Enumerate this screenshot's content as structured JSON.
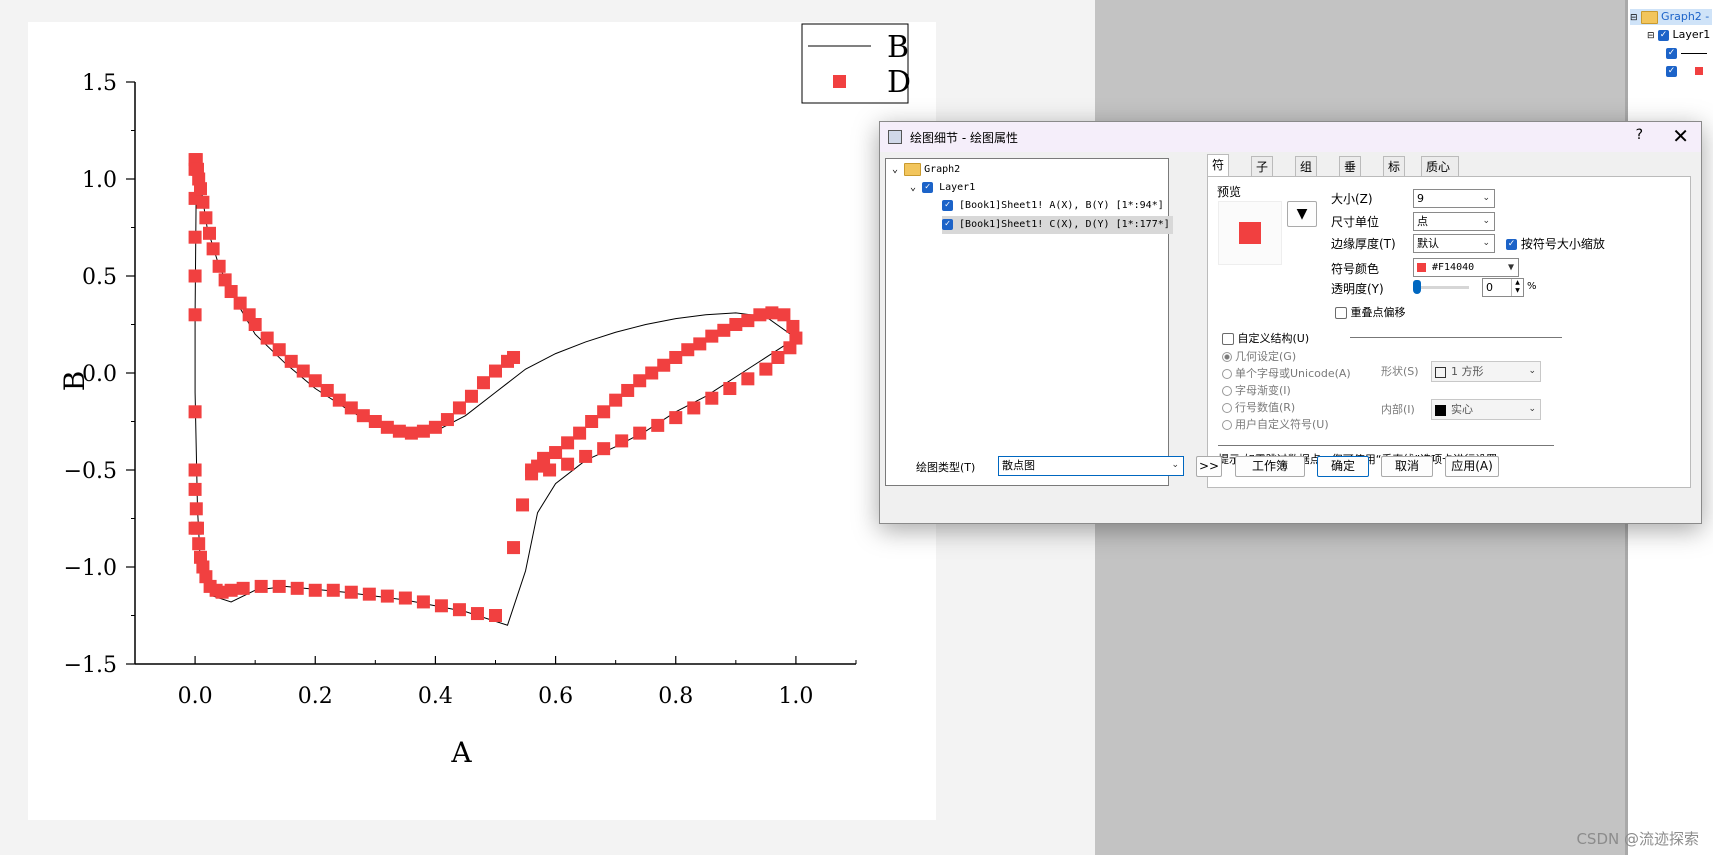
{
  "chart_data": {
    "type": "scatter",
    "xlabel": "A",
    "ylabel": "B",
    "xlim": [
      -0.1,
      1.1
    ],
    "ylim": [
      -1.5,
      1.5
    ],
    "xticks": [
      "0.0",
      "0.2",
      "0.4",
      "0.6",
      "0.8",
      "1.0"
    ],
    "yticks": [
      "1.5",
      "1.0",
      "0.5",
      "0.0",
      "−0.5",
      "−1.0",
      "−1.5"
    ],
    "legend_position": "top-right",
    "series": [
      {
        "name": "B",
        "style": "line",
        "color": "#000000",
        "x": [
          0.0,
          0.002,
          0.005,
          0.01,
          0.02,
          0.04,
          0.07,
          0.1,
          0.15,
          0.2,
          0.25,
          0.3,
          0.35,
          0.4,
          0.45,
          0.5,
          0.55,
          0.6,
          0.65,
          0.7,
          0.75,
          0.8,
          0.85,
          0.9,
          0.95,
          1.0,
          0.95,
          0.9,
          0.85,
          0.8,
          0.75,
          0.7,
          0.65,
          0.6,
          0.57,
          0.55,
          0.52,
          0.45,
          0.35,
          0.25,
          0.15,
          0.1,
          0.06,
          0.03,
          0.015,
          0.008,
          0.004,
          0.002,
          0.0,
          0.0
        ],
        "y": [
          0.3,
          1.0,
          1.05,
          0.95,
          0.75,
          0.55,
          0.36,
          0.2,
          0.05,
          -0.08,
          -0.18,
          -0.27,
          -0.31,
          -0.3,
          -0.22,
          -0.1,
          0.02,
          0.1,
          0.16,
          0.21,
          0.25,
          0.28,
          0.3,
          0.31,
          0.29,
          0.18,
          0.08,
          -0.02,
          -0.12,
          -0.2,
          -0.3,
          -0.38,
          -0.45,
          -0.57,
          -0.72,
          -1.02,
          -1.3,
          -1.23,
          -1.17,
          -1.13,
          -1.1,
          -1.12,
          -1.18,
          -1.15,
          -1.05,
          -0.93,
          -0.7,
          -0.4,
          -0.1,
          0.3
        ]
      },
      {
        "name": "D",
        "style": "square",
        "color": "#F14040",
        "x": [
          0.0,
          0.0,
          0.0,
          0.0,
          0.0,
          0.0,
          0.0,
          0.0,
          0.0,
          0.002,
          0.004,
          0.006,
          0.009,
          0.013,
          0.018,
          0.024,
          0.03,
          0.04,
          0.05,
          0.06,
          0.075,
          0.09,
          0.1,
          0.12,
          0.14,
          0.16,
          0.18,
          0.2,
          0.22,
          0.24,
          0.26,
          0.28,
          0.3,
          0.32,
          0.34,
          0.36,
          0.38,
          0.4,
          0.42,
          0.44,
          0.46,
          0.48,
          0.5,
          0.52,
          0.53,
          0.545,
          0.56,
          0.57,
          0.58,
          0.6,
          0.62,
          0.64,
          0.66,
          0.68,
          0.7,
          0.72,
          0.74,
          0.76,
          0.78,
          0.8,
          0.82,
          0.84,
          0.86,
          0.88,
          0.9,
          0.92,
          0.94,
          0.96,
          0.98,
          0.995,
          1.0,
          0.99,
          0.97,
          0.95,
          0.92,
          0.89,
          0.86,
          0.83,
          0.8,
          0.77,
          0.74,
          0.71,
          0.68,
          0.65,
          0.62,
          0.59,
          0.56,
          0.53,
          0.5,
          0.47,
          0.44,
          0.41,
          0.38,
          0.35,
          0.32,
          0.29,
          0.26,
          0.23,
          0.2,
          0.17,
          0.14,
          0.11,
          0.08,
          0.06,
          0.045,
          0.035,
          0.025,
          0.018,
          0.013,
          0.009,
          0.006,
          0.004,
          0.002,
          0.0
        ],
        "y": [
          0.3,
          0.5,
          0.7,
          0.9,
          1.05,
          1.1,
          -0.2,
          -0.5,
          -0.8,
          1.1,
          1.05,
          1.0,
          0.95,
          0.88,
          0.8,
          0.72,
          0.64,
          0.55,
          0.48,
          0.42,
          0.36,
          0.3,
          0.25,
          0.18,
          0.12,
          0.06,
          0.01,
          -0.04,
          -0.09,
          -0.14,
          -0.18,
          -0.22,
          -0.25,
          -0.28,
          -0.3,
          -0.31,
          -0.3,
          -0.28,
          -0.24,
          -0.18,
          -0.12,
          -0.05,
          0.01,
          0.06,
          0.08,
          -0.68,
          -0.5,
          -0.48,
          -0.44,
          -0.41,
          -0.36,
          -0.31,
          -0.25,
          -0.2,
          -0.14,
          -0.09,
          -0.04,
          0.0,
          0.04,
          0.08,
          0.12,
          0.15,
          0.19,
          0.22,
          0.25,
          0.27,
          0.3,
          0.31,
          0.3,
          0.24,
          0.18,
          0.13,
          0.08,
          0.02,
          -0.03,
          -0.08,
          -0.13,
          -0.18,
          -0.23,
          -0.27,
          -0.31,
          -0.35,
          -0.39,
          -0.43,
          -0.47,
          -0.5,
          -0.52,
          -0.9,
          -1.25,
          -1.24,
          -1.22,
          -1.2,
          -1.18,
          -1.16,
          -1.15,
          -1.14,
          -1.13,
          -1.12,
          -1.12,
          -1.11,
          -1.1,
          -1.1,
          -1.11,
          -1.12,
          -1.13,
          -1.12,
          -1.1,
          -1.05,
          -1.0,
          -0.95,
          -0.88,
          -0.8,
          -0.7,
          -0.6
        ]
      }
    ]
  },
  "project": {
    "graph_label": "Graph2 - 绘",
    "layer_label": "Layer1"
  },
  "dialog": {
    "title": "绘图细节 - 绘图属性",
    "help": "?",
    "close": "✕",
    "tree": {
      "graph": "Graph2",
      "layer": "Layer1",
      "plot1": "[Book1]Sheet1! A(X), B(Y) [1*:94*]",
      "plot2": "[Book1]Sheet1! C(X), D(Y) [1*:177*]"
    },
    "tabs": [
      "符号",
      "子集",
      "组图",
      "垂直线",
      "标签",
      "质心(Pro)"
    ],
    "preview_label": "预览",
    "size_label": "大小(Z)",
    "size_value": "9",
    "unit_label": "尺寸单位",
    "unit_value": "点",
    "edge_label": "边缘厚度(T)",
    "edge_value": "默认",
    "scale_label": "按符号大小缩放",
    "color_label": "符号颜色",
    "color_value": "#F14040",
    "symbol_color": "#F14040",
    "transparency_label": "透明度(Y)",
    "transparency_value": "0",
    "transparency_unit": "%",
    "transparency_level": 0,
    "overlap_label": "重叠点偏移",
    "custom_label": "自定义结构(U)",
    "radio_geometric": "几何设定(G)",
    "radio_unicode": "单个字母或Unicode(A)",
    "radio_gradient": "字母渐变(I)",
    "radio_rowvalue": "行号数值(R)",
    "radio_user": "用户自定义符号(U)",
    "shape_label": "形状(S)",
    "shape_value": "1 方形",
    "interior_label": "内部(I)",
    "interior_value": "实心",
    "hint": "提示:如需跳过数据点，您可使用“垂直线”选项卡进行设置",
    "plot_type_label": "绘图类型(T)",
    "plot_type_value": "散点图",
    "expand_button": ">>",
    "workbook_button": "工作簿",
    "ok_button": "确定",
    "cancel_button": "取消",
    "apply_button": "应用(A)"
  },
  "watermark": "CSDN @流迹探索"
}
